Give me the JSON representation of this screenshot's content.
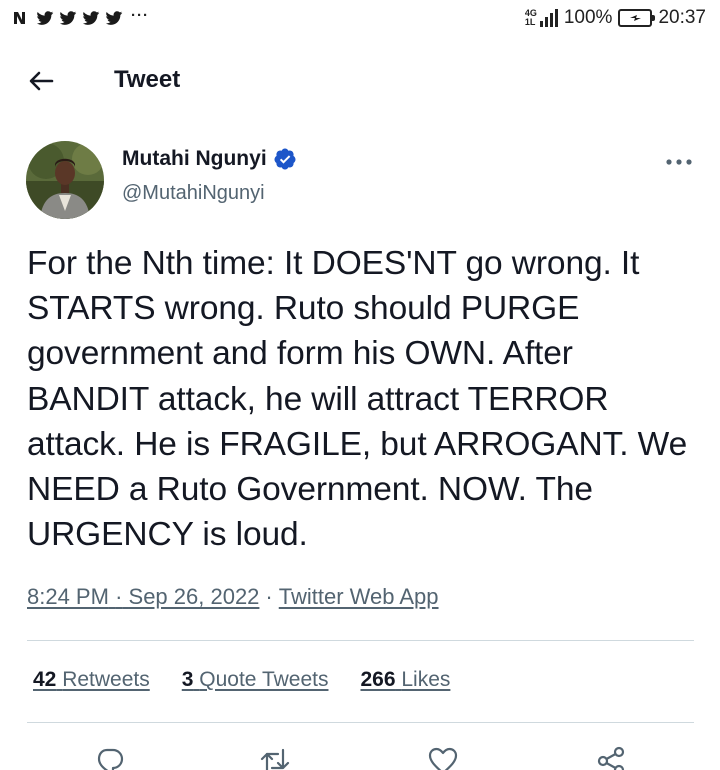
{
  "status_bar": {
    "notification_icons": [
      "news-app-icon",
      "twitter-icon",
      "twitter-icon",
      "twitter-icon",
      "twitter-icon"
    ],
    "more_indicator": "···",
    "network_label_top": "4G",
    "network_label_bottom": "1L",
    "battery_text": "100%",
    "time": "20:37",
    "battery_level_percent": 100
  },
  "header": {
    "title": "Tweet"
  },
  "tweet": {
    "author": {
      "name": "Mutahi Ngunyi",
      "handle": "@MutahiNgunyi",
      "verified": true
    },
    "text": "For the Nth time: It DOES'NT go wrong. It STARTS wrong. Ruto should PURGE government and form his OWN. After BANDIT attack, he will attract TERROR attack. He is FRAGILE, but ARROGANT. We NEED a Ruto Government. NOW. The URGENCY is loud.",
    "time": "8:24 PM",
    "separator": "·",
    "date": "Sep 26, 2022",
    "source": "Twitter Web App",
    "stats": {
      "retweets_count": "42",
      "retweets_label": "Retweets",
      "quote_tweets_count": "3",
      "quote_tweets_label": "Quote Tweets",
      "likes_count": "266",
      "likes_label": "Likes"
    }
  },
  "colors": {
    "text_primary": "#141823",
    "text_secondary": "#536471",
    "verified_blue": "#1d9bf0",
    "divider": "#cfd9de",
    "battery_green": "#2ecc40"
  }
}
